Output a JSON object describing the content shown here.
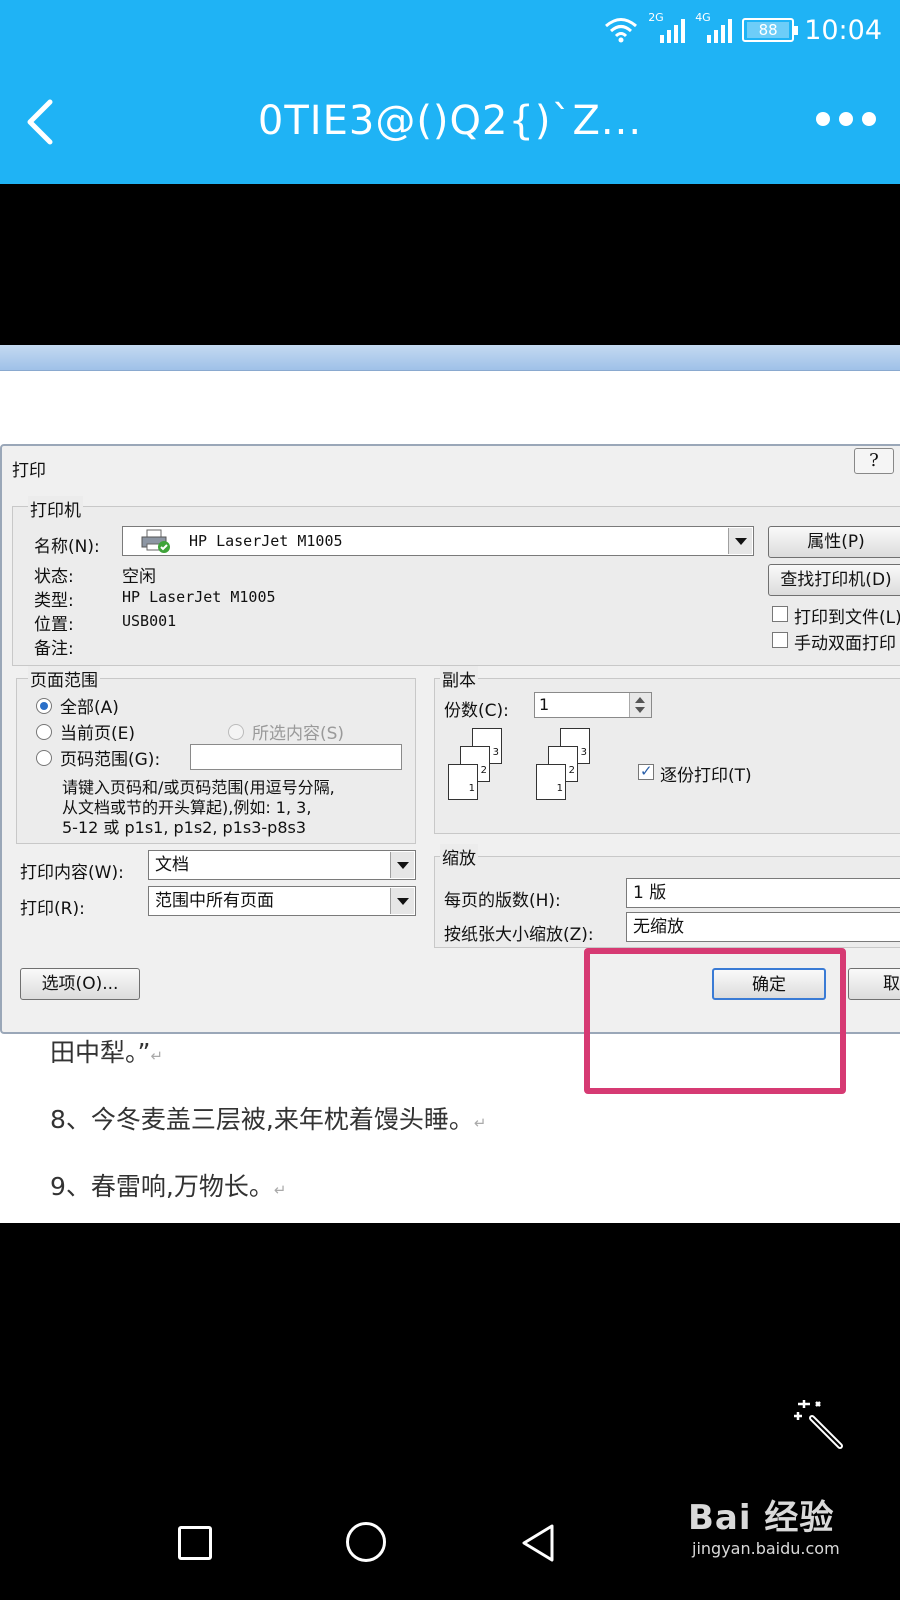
{
  "status_bar": {
    "net1": "2G",
    "net2": "4G",
    "battery": "88",
    "time": "10:04"
  },
  "appbar": {
    "title": "0TIE3@()Q2{)`Z..."
  },
  "dialog": {
    "title": "打印",
    "help": "?",
    "printer_group": "打印机",
    "name_label": "名称(N):",
    "printer_name": "HP LaserJet M1005",
    "properties_btn": "属性(P)",
    "find_printer_btn": "查找打印机(D)",
    "status_label": "状态:",
    "status_value": "空闲",
    "type_label": "类型:",
    "type_value": "HP LaserJet M1005",
    "where_label": "位置:",
    "where_value": "USB001",
    "comment_label": "备注:",
    "print_to_file": "打印到文件(L)",
    "manual_duplex": "手动双面打印",
    "range_group": "页面范围",
    "range_all": "全部(A)",
    "range_current": "当前页(E)",
    "range_selection": "所选内容(S)",
    "range_pages": "页码范围(G):",
    "range_hint1": "请键入页码和/或页码范围(用逗号分隔,",
    "range_hint2": "从文档或节的开头算起),例如: 1, 3,",
    "range_hint3": "5-12 或 p1s1, p1s2, p1s3-p8s3",
    "copies_group": "副本",
    "copies_label": "份数(C):",
    "copies_value": "1",
    "collate": "逐份打印(T)",
    "print_what_label": "打印内容(W):",
    "print_what_value": "文档",
    "print_label": "打印(R):",
    "print_value": "范围中所有页面",
    "zoom_group": "缩放",
    "pages_per_sheet_label": "每页的版数(H):",
    "pages_per_sheet_value": "1 版",
    "scale_label": "按纸张大小缩放(Z):",
    "scale_value": "无缩放",
    "options_btn": "选项(O)...",
    "ok_btn": "确定",
    "cancel_btn": "取消",
    "stack_numbers": [
      "3",
      "2",
      "1"
    ]
  },
  "document": {
    "line1": "田中犁。”",
    "line2": "8、今冬麦盖三层被,来年枕着馒头睡。",
    "line3": "9、春雷响,万物长。",
    "para_mark": "↵"
  },
  "watermark": {
    "logo": "Bai 经验",
    "sub": "jingyan.baidu.com"
  },
  "colors": {
    "appbar": "#1fb3f5",
    "highlight": "#d63a73"
  },
  "icons": [
    "wifi-icon",
    "signal-icon",
    "battery-icon",
    "back-icon",
    "more-icon",
    "printer-icon",
    "magic-wand-icon",
    "nav-recent-icon",
    "nav-home-icon",
    "nav-back-icon"
  ]
}
